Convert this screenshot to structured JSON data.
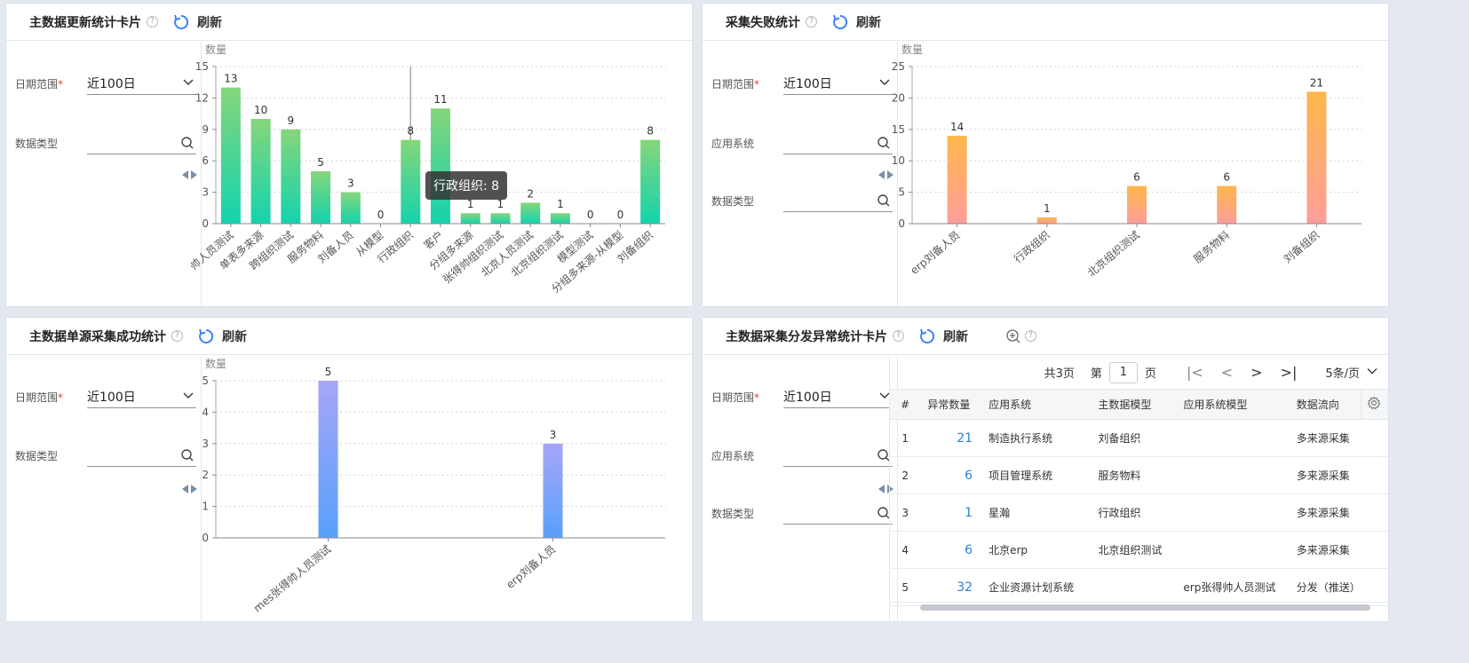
{
  "common": {
    "refresh_label": "刷新",
    "help_glyph": "?",
    "date_range_label": "日期范围",
    "required_mark": "*",
    "date_range_value": "近100日",
    "data_type_label": "数据类型",
    "app_system_label": "应用系统"
  },
  "card1": {
    "title": "主数据更新统计卡片",
    "tooltip": "行政组织: 8"
  },
  "card2": {
    "title": "采集失败统计"
  },
  "card3": {
    "title": "主数据单源采集成功统计"
  },
  "card4": {
    "title": "主数据采集分发异常统计卡片",
    "pager": {
      "total": "共3页",
      "page_prefix": "第",
      "page_value": "1",
      "page_suffix": "页",
      "first": "|<",
      "prev": "<",
      "next": ">",
      "last": ">|",
      "page_size": "5条/页"
    },
    "columns": [
      "#",
      "异常数量",
      "应用系统",
      "主数据模型",
      "应用系统模型",
      "数据流向"
    ],
    "rows": [
      {
        "idx": "1",
        "count": "21",
        "system": "制造执行系统",
        "model": "刘备组织",
        "sys_model": "",
        "flow": "多来源采集"
      },
      {
        "idx": "2",
        "count": "6",
        "system": "项目管理系统",
        "model": "服务物料",
        "sys_model": "",
        "flow": "多来源采集"
      },
      {
        "idx": "3",
        "count": "1",
        "system": "星瀚",
        "model": "行政组织",
        "sys_model": "",
        "flow": "多来源采集"
      },
      {
        "idx": "4",
        "count": "6",
        "system": "北京erp",
        "model": "北京组织测试",
        "sys_model": "",
        "flow": "多来源采集"
      },
      {
        "idx": "5",
        "count": "32",
        "system": "企业资源计划系统",
        "model": "",
        "sys_model": "erp张得帅人员测试",
        "flow": "分发（推送）"
      }
    ]
  },
  "chart_data": [
    {
      "type": "bar",
      "ylabel": "数量",
      "ylim": [
        0,
        15
      ],
      "yticks": [
        0,
        3,
        6,
        9,
        12,
        15
      ],
      "categories": [
        "帅人员测试",
        "单表多来源",
        "跨组织测试",
        "服务物料",
        "刘备人员",
        "从模型",
        "行政组织",
        "客户",
        "分组多来源",
        "张得帅组织测试",
        "北京人员测试",
        "北京组织测试",
        "模型测试",
        "分组多来源-从模型",
        "刘备组织"
      ],
      "values": [
        13,
        10,
        9,
        5,
        3,
        0,
        8,
        11,
        1,
        1,
        2,
        1,
        0,
        0,
        8
      ],
      "colors": [
        "#85d67a",
        "#13d3ae"
      ],
      "grid": true
    },
    {
      "type": "bar",
      "ylabel": "数量",
      "ylim": [
        0,
        25
      ],
      "yticks": [
        0,
        5,
        10,
        15,
        20,
        25
      ],
      "categories": [
        "erp刘备人员",
        "行政组织",
        "北京组织测试",
        "服务物料",
        "刘备组织"
      ],
      "values": [
        14,
        1,
        6,
        6,
        21
      ],
      "colors": [
        "#ffb74a",
        "#ff9e9a"
      ],
      "grid": true
    },
    {
      "type": "bar",
      "ylabel": "数量",
      "ylim": [
        0,
        5
      ],
      "yticks": [
        0,
        1,
        2,
        3,
        4,
        5
      ],
      "categories": [
        "mes张得帅人员测试",
        "erp刘备人员"
      ],
      "values": [
        5,
        3
      ],
      "colors": [
        "#a7a6f8",
        "#58a0fb"
      ],
      "grid": true
    }
  ]
}
